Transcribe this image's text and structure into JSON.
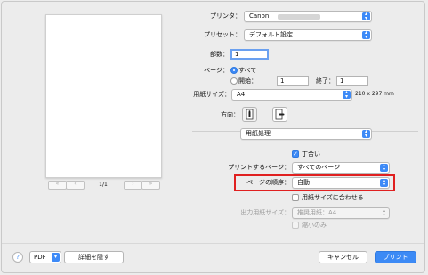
{
  "preview": {
    "page_indicator": "1/1"
  },
  "printer": {
    "label": "プリンタ：",
    "value": "Canon"
  },
  "preset": {
    "label": "プリセット：",
    "value": "デフォルト設定"
  },
  "copies": {
    "label": "部数：",
    "value": "1"
  },
  "pages": {
    "label": "ページ：",
    "all_label": "すべて",
    "from_label": "開始：",
    "from_value": "1",
    "to_label": "終了：",
    "to_value": "1"
  },
  "paper_size": {
    "label": "用紙サイズ：",
    "value": "A4",
    "dimensions": "210 x 297 mm"
  },
  "orientation": {
    "label": "方向："
  },
  "section_popup": {
    "value": "用紙処理"
  },
  "collate": {
    "label": "丁合い",
    "checked": true
  },
  "pages_to_print": {
    "label": "プリントするページ：",
    "value": "すべてのページ"
  },
  "page_order": {
    "label": "ページの順序：",
    "value": "自動"
  },
  "scale_to_fit": {
    "label": "用紙サイズに合わせる",
    "checked": false
  },
  "dest_paper_size": {
    "label": "出力用紙サイズ：",
    "value": "推奨用紙：A4"
  },
  "scale_down_only": {
    "label": "縮小のみ"
  },
  "footer": {
    "help": "?",
    "pdf": "PDF",
    "hide_details": "詳細を隠す",
    "cancel": "キャンセル",
    "print": "プリント"
  },
  "colors": {
    "accent": "#3d8af7",
    "highlight_border": "#e02020"
  },
  "icons": [
    "help-icon",
    "chevron-down-icon",
    "portrait-icon",
    "landscape-icon",
    "first-page-icon",
    "prev-page-icon",
    "next-page-icon",
    "last-page-icon"
  ]
}
